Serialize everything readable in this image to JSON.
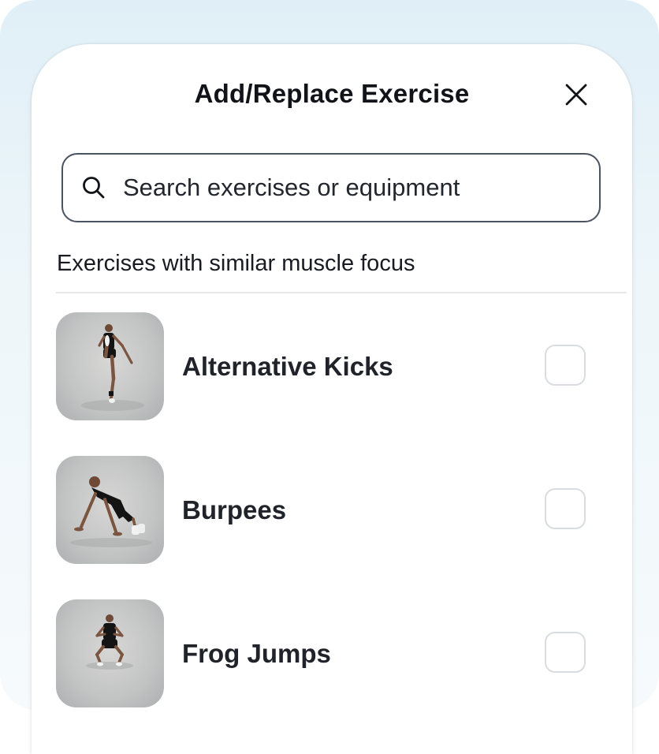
{
  "dialog": {
    "title": "Add/Replace Exercise",
    "close_icon": "close-icon"
  },
  "search": {
    "placeholder": "Search exercises or equipment",
    "value": "",
    "icon": "search-icon"
  },
  "section": {
    "label": "Exercises with similar muscle focus"
  },
  "exercises": [
    {
      "name": "Alternative Kicks",
      "checked": false
    },
    {
      "name": "Burpees",
      "checked": false
    },
    {
      "name": "Frog Jumps",
      "checked": false
    }
  ],
  "colors": {
    "background_top": "#e0eff7",
    "sheet": "#ffffff",
    "text_primary": "#111318",
    "border_search": "#4b5260",
    "border_checkbox": "#d9dce1",
    "divider": "#e6e8ec",
    "athlete_outfit": "#141414"
  }
}
